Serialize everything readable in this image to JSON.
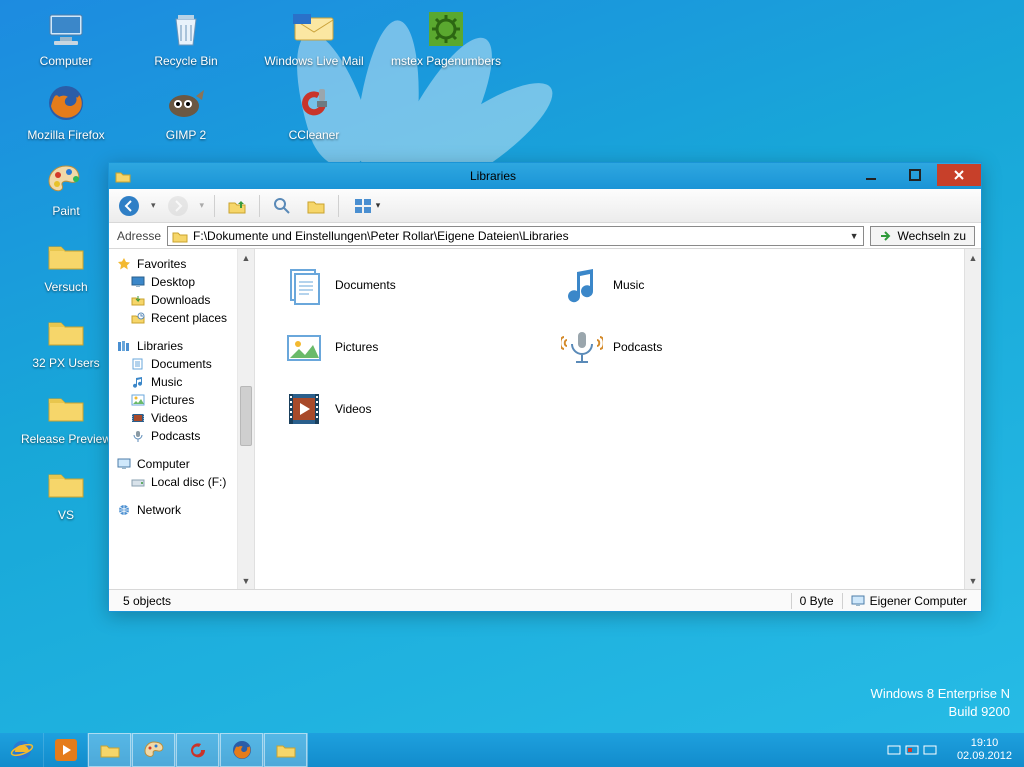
{
  "desktop_icons": {
    "row1": [
      {
        "name": "computer",
        "label": "Computer"
      },
      {
        "name": "recycle-bin",
        "label": "Recycle Bin"
      },
      {
        "name": "windows-live-mail",
        "label": "Windows Live Mail"
      },
      {
        "name": "mstex-pagenumbers",
        "label": "mstex Pagenumbers"
      }
    ],
    "row2": [
      {
        "name": "mozilla-firefox",
        "label": "Mozilla Firefox"
      },
      {
        "name": "gimp",
        "label": "GIMP 2"
      },
      {
        "name": "ccleaner",
        "label": "CCleaner"
      }
    ],
    "col1": [
      {
        "name": "paint",
        "label": "Paint"
      },
      {
        "name": "versuch",
        "label": "Versuch"
      },
      {
        "name": "32px-users",
        "label": "32 PX Users"
      },
      {
        "name": "release-preview",
        "label": "Release Preview"
      },
      {
        "name": "vs",
        "label": "VS"
      }
    ]
  },
  "window": {
    "title": "Libraries",
    "address_label": "Adresse",
    "address_value": "F:\\Dokumente und Einstellungen\\Peter Rollar\\Eigene Dateien\\Libraries",
    "go_label": "Wechseln zu",
    "nav": {
      "favorites": {
        "label": "Favorites",
        "items": [
          "Desktop",
          "Downloads",
          "Recent places"
        ]
      },
      "libraries": {
        "label": "Libraries",
        "items": [
          "Documents",
          "Music",
          "Pictures",
          "Videos",
          "Podcasts"
        ]
      },
      "computer": {
        "label": "Computer",
        "items": [
          "Local disc (F:)"
        ]
      },
      "network": {
        "label": "Network"
      }
    },
    "content_items": [
      {
        "name": "documents",
        "label": "Documents"
      },
      {
        "name": "music",
        "label": "Music"
      },
      {
        "name": "pictures",
        "label": "Pictures"
      },
      {
        "name": "podcasts",
        "label": "Podcasts"
      },
      {
        "name": "videos",
        "label": "Videos"
      }
    ],
    "status": {
      "objects": "5 objects",
      "size": "0 Byte",
      "location": "Eigener Computer"
    }
  },
  "watermark": {
    "line1": "Windows 8 Enterprise N",
    "line2": "Build 9200"
  },
  "taskbar": {
    "items": [
      "ie",
      "media",
      "explorer",
      "paint",
      "ccleaner",
      "firefox",
      "explorer2"
    ],
    "clock": {
      "time": "19:10",
      "date": "02.09.2012"
    }
  }
}
